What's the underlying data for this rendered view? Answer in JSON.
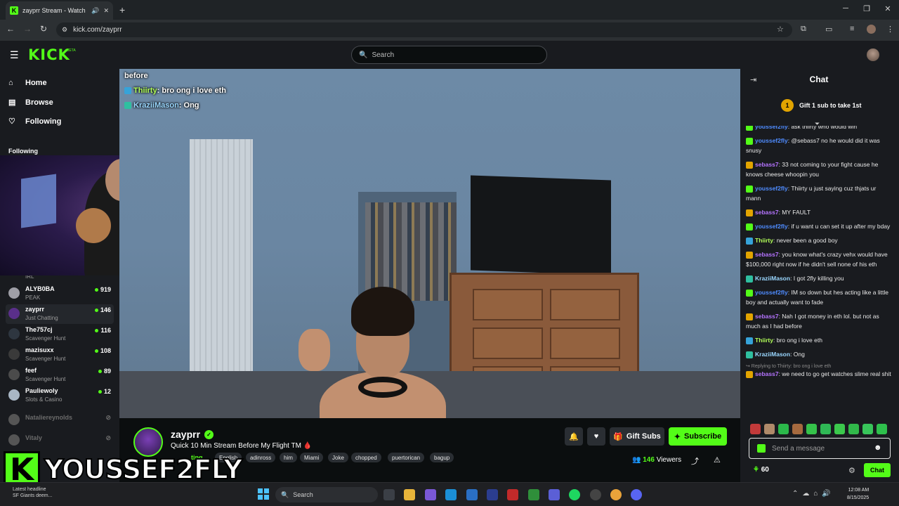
{
  "browser": {
    "tab_title": "zayprr Stream - Watch Live",
    "tab_favicon": "K",
    "url": "kick.com/zayprr",
    "accent": "#53fc18"
  },
  "header": {
    "logo": "KICK",
    "beta": "BETA",
    "search_placeholder": "Search"
  },
  "sidebar": {
    "nav": [
      {
        "label": "Home",
        "icon": "home-icon"
      },
      {
        "label": "Browse",
        "icon": "browse-icon"
      },
      {
        "label": "Following",
        "icon": "heart-icon"
      }
    ],
    "following_title": "Following",
    "irl_label": "IRL",
    "channels": [
      {
        "name": "ALYB0BA",
        "category": "PEAK",
        "viewers": "919"
      },
      {
        "name": "zayprr",
        "category": "Just Chatting",
        "viewers": "146"
      },
      {
        "name": "The757cj",
        "category": "Scavenger Hunt",
        "viewers": "116"
      },
      {
        "name": "mazisuxx",
        "category": "Scavenger Hunt",
        "viewers": "108"
      },
      {
        "name": "feef",
        "category": "Scavenger Hunt",
        "viewers": "89"
      },
      {
        "name": "Pauliewoly",
        "category": "Slots & Casino",
        "viewers": "12"
      },
      {
        "name": "Nataliereynolds",
        "category": "",
        "viewers": ""
      },
      {
        "name": "Vitaly",
        "category": "",
        "viewers": ""
      }
    ]
  },
  "video_overlay": {
    "line0": "before",
    "line1_user": "Thiirty",
    "line1_text": ": bro ong i love eth",
    "line2_user": "KraziiMason",
    "line2_text": ": Ong"
  },
  "stream": {
    "name": "zayprr",
    "title": "Quick 10 Min Stream Before My Flight TM 🩸",
    "category": "ting",
    "tags": [
      "English",
      "adinross",
      "him",
      "Miami",
      "Joke",
      "chopped",
      "puertorican",
      "bagup"
    ],
    "gift_subs": "Gift Subs",
    "subscribe": "Subscribe",
    "viewers": "146",
    "viewers_label": "Viewers"
  },
  "watermark": {
    "k": "K",
    "name": "YOUSSEF2FLY"
  },
  "chat": {
    "title": "Chat",
    "gift_badge": "1",
    "gift_banner": "Gift 1 sub to take 1st",
    "messages": [
      {
        "user": "youssef2fly",
        "text": ": ask thiirty who would win",
        "color": "#4f8cff",
        "badge": "#53fc18"
      },
      {
        "user": "youssef2fly",
        "text": ": @sebass7 no he would did it was snusy",
        "color": "#4f8cff",
        "badge": "#53fc18"
      },
      {
        "user": "sebass7",
        "text": ": 33 not coming to your fight cause he knows cheese whoopin you",
        "color": "#b574ff",
        "badge": "#e2a400"
      },
      {
        "user": "youssef2fly",
        "text": ": Thiirty u just saying cuz thjats ur mann",
        "color": "#4f8cff",
        "badge": "#53fc18"
      },
      {
        "user": "sebass7",
        "text": ": MY FAULT",
        "color": "#b574ff",
        "badge": "#e2a400"
      },
      {
        "user": "youssef2fly",
        "text": ": if u want u can set it up after my bday",
        "color": "#4f8cff",
        "badge": "#53fc18"
      },
      {
        "user": "Thiirty",
        "text": ": never been a good boy",
        "color": "#b2ff59",
        "badge": "#36a3d9"
      },
      {
        "user": "sebass7",
        "text": ": you know what's crazy vehx would have $100,000 right now if he didn't sell none of his eth",
        "color": "#b574ff",
        "badge": "#e2a400"
      },
      {
        "user": "KraziiMason",
        "text": ": I got 2fly killing you",
        "color": "#9ad7ff",
        "badge": "#2fbfa0"
      },
      {
        "user": "youssef2fly",
        "text": ": IM so down but hes acting like a little boy and actually want to fade",
        "color": "#4f8cff",
        "badge": "#53fc18"
      },
      {
        "user": "sebass7",
        "text": ": Nah I got money in eth lol. but not as much as I had before",
        "color": "#b574ff",
        "badge": "#e2a400"
      },
      {
        "user": "Thiirty",
        "text": ": bro ong i love eth",
        "color": "#b2ff59",
        "badge": "#36a3d9"
      },
      {
        "user": "KraziiMason",
        "text": ": Ong",
        "color": "#9ad7ff",
        "badge": "#2fbfa0"
      }
    ],
    "reply_to": "↪ Replying to Thiirty: bro ong i love eth",
    "last_user": "sebass7",
    "last_text": ": we need to go get watches slime real shit",
    "input_placeholder": "Send a message",
    "points": "60",
    "send_label": "Chat"
  },
  "taskbar": {
    "news_line1": "Latest headline",
    "news_line2": "SF Giants deem...",
    "search_placeholder": "Search",
    "time": "12:08 AM",
    "date": "8/15/2025"
  }
}
